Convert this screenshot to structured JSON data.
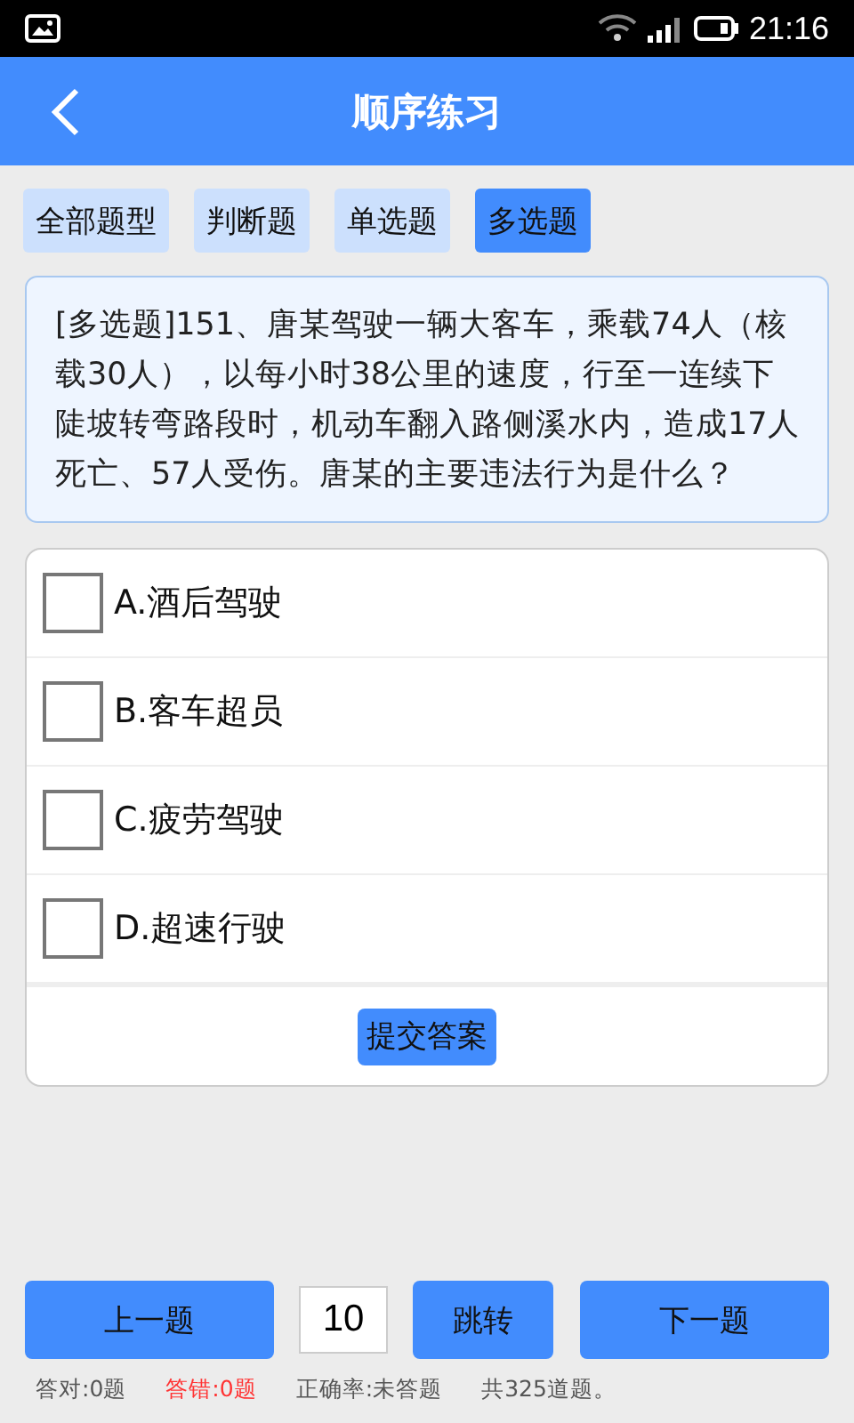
{
  "status_bar": {
    "time": "21:16"
  },
  "header": {
    "title": "顺序练习"
  },
  "tabs": [
    {
      "label": "全部题型",
      "selected": false
    },
    {
      "label": "判断题",
      "selected": false
    },
    {
      "label": "单选题",
      "selected": false
    },
    {
      "label": "多选题",
      "selected": true
    }
  ],
  "question": {
    "text": "[多选题]151、唐某驾驶一辆大客车，乘载74人（核载30人），以每小时38公里的速度，行至一连续下陡坡转弯路段时，机动车翻入路侧溪水内，造成17人死亡、57人受伤。唐某的主要违法行为是什么？"
  },
  "options": [
    {
      "label": "A.酒后驾驶",
      "checked": false
    },
    {
      "label": "B.客车超员",
      "checked": false
    },
    {
      "label": "C.疲劳驾驶",
      "checked": false
    },
    {
      "label": "D.超速行驶",
      "checked": false
    }
  ],
  "submit_button": "提交答案",
  "navigation": {
    "previous": "上一题",
    "jump_value": "10",
    "jump": "跳转",
    "next": "下一题"
  },
  "stats": [
    {
      "text": "答对:0题",
      "color": "#555555"
    },
    {
      "text": "答错:0题",
      "color": "#ff3333"
    },
    {
      "text": "正确率:未答题",
      "color": "#555555"
    },
    {
      "text": "共325道题。",
      "color": "#555555"
    }
  ]
}
